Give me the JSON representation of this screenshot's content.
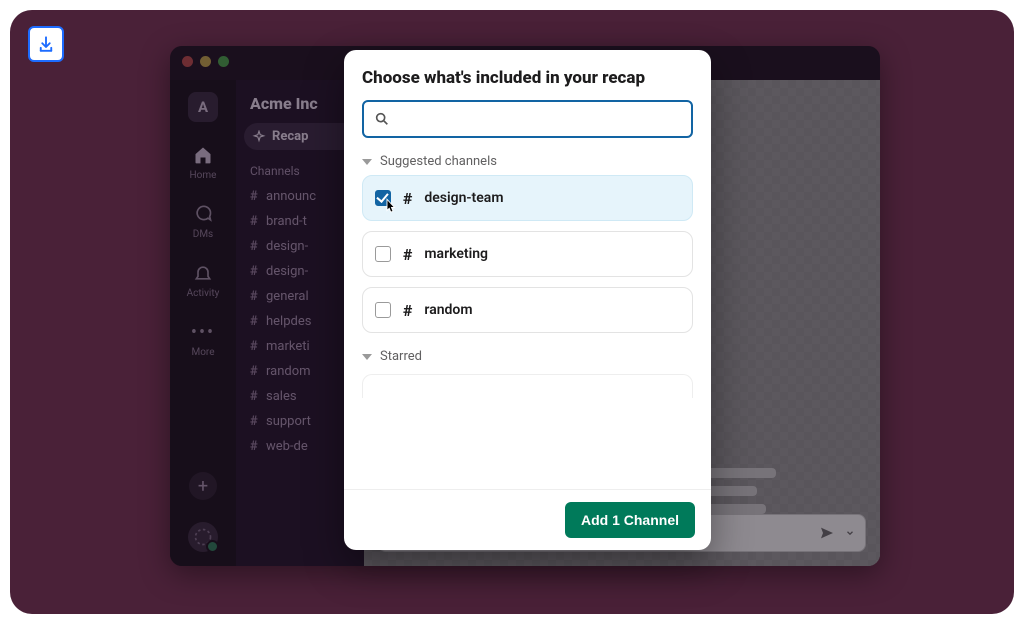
{
  "download_badge": {
    "icon": "download-icon"
  },
  "workspace": {
    "name": "Acme Inc",
    "initial": "A"
  },
  "rail": {
    "items": [
      {
        "id": "home",
        "label": "Home"
      },
      {
        "id": "dms",
        "label": "DMs"
      },
      {
        "id": "activity",
        "label": "Activity"
      },
      {
        "id": "more",
        "label": "More"
      }
    ]
  },
  "sidebar": {
    "recap_label": "Recap",
    "channels_label": "Channels",
    "channels": [
      "announc",
      "brand-t",
      "design-",
      "design-",
      "general",
      "helpdes",
      "marketi",
      "random",
      "sales",
      "support",
      "web-de"
    ]
  },
  "modal": {
    "title": "Choose what's included in your recap",
    "search_placeholder": "",
    "sections": [
      {
        "label": "Suggested channels",
        "items": [
          {
            "name": "design-team",
            "checked": true
          },
          {
            "name": "marketing",
            "checked": false
          },
          {
            "name": "random",
            "checked": false
          }
        ]
      },
      {
        "label": "Starred",
        "items": []
      }
    ],
    "selected_count": 1,
    "primary_button": "Add 1 Channel"
  },
  "colors": {
    "accent": "#007a5a",
    "link": "#1264a3",
    "bg": "#4a2138"
  }
}
